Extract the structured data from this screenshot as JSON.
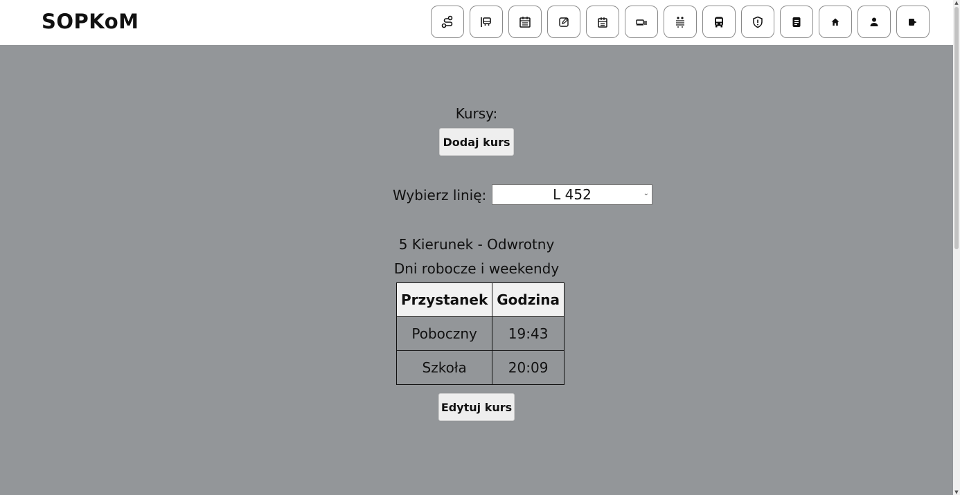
{
  "app": {
    "logo": "SOPKoM"
  },
  "nav": {
    "items": [
      {
        "icon": "route-icon"
      },
      {
        "icon": "bus-stop-icon"
      },
      {
        "icon": "calendar-icon"
      },
      {
        "icon": "edit-icon"
      },
      {
        "icon": "schedule-icon"
      },
      {
        "icon": "vehicle-depot-icon"
      },
      {
        "icon": "people-icon"
      },
      {
        "icon": "bus-icon"
      },
      {
        "icon": "shield-icon"
      },
      {
        "icon": "document-icon"
      },
      {
        "icon": "home-icon"
      },
      {
        "icon": "user-icon"
      },
      {
        "icon": "logout-icon"
      }
    ]
  },
  "main": {
    "heading": "Kursy:",
    "add_button": "Dodaj kurs",
    "line_label": "Wybierz linię:",
    "line_select": {
      "value": "L 452"
    },
    "direction": "5 Kierunek - Odwrotny",
    "days": "Dni robocze i weekendy",
    "table": {
      "headers": [
        "Przystanek",
        "Godzina"
      ],
      "rows": [
        [
          "Poboczny",
          "19:43"
        ],
        [
          "Szkoła",
          "20:09"
        ]
      ]
    },
    "edit_button": "Edytuj kurs"
  },
  "colors": {
    "background": "#939699",
    "topbar": "#ffffff",
    "button_bg": "#eeeeee"
  }
}
